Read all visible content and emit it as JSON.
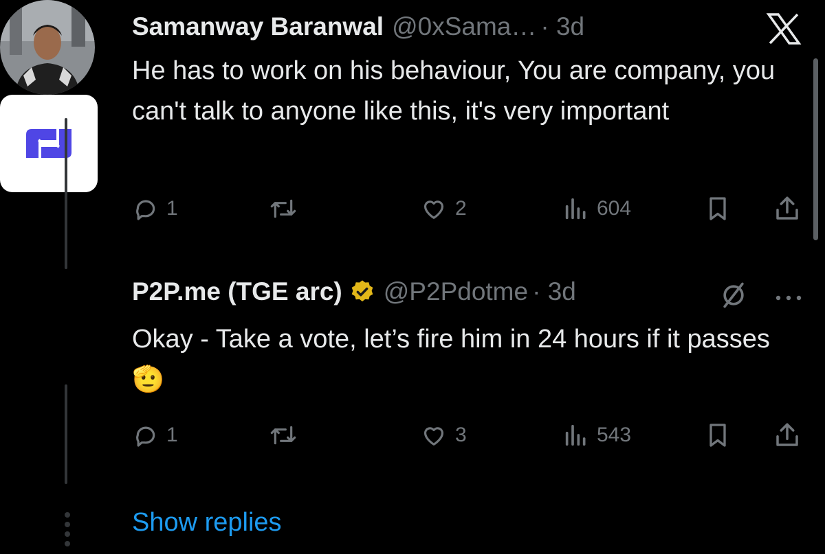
{
  "tweet1": {
    "name": "Samanway Baranwal",
    "handle": "@0xSama…",
    "time": "· 3d",
    "text": "He has to work on his behaviour, You are company, you can't talk to anyone like this, it's very important",
    "replies": "1",
    "likes": "2",
    "views": "604"
  },
  "tweet2": {
    "name": "P2P.me (TGE arc)",
    "handle": "@P2Pdotme",
    "time": "· 3d",
    "text": "Okay - Take a vote, let’s fire him in 24 hours if it passes 🫡",
    "replies": "1",
    "likes": "3",
    "views": "543"
  },
  "show_replies": "Show replies",
  "colors": {
    "background": "#000000",
    "primary_text": "#e7e9ea",
    "secondary_text": "#71767b",
    "link": "#1d9bf0",
    "verified_badge": "#e2b719",
    "brand_logo": "#4f46e5"
  },
  "icons": [
    "x-logo-icon",
    "reply-icon",
    "retweet-icon",
    "like-icon",
    "views-icon",
    "bookmark-icon",
    "share-icon",
    "verified-badge-icon",
    "grok-icon",
    "more-icon"
  ]
}
